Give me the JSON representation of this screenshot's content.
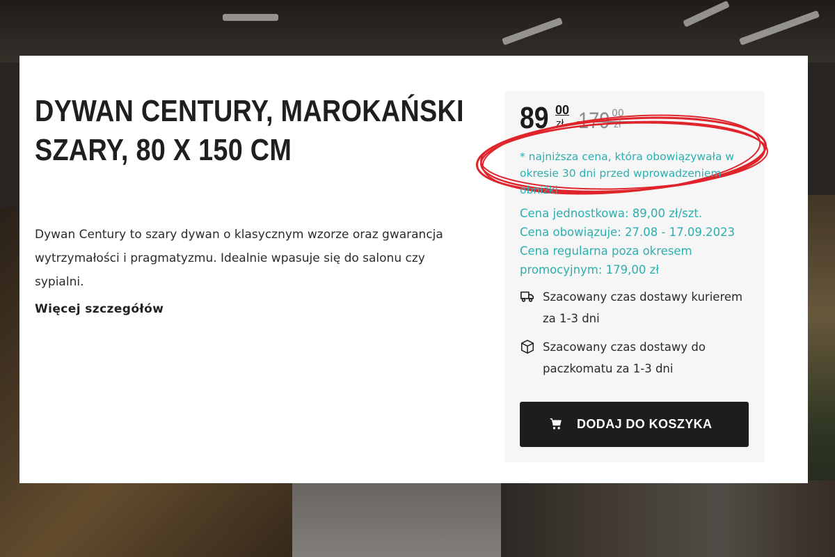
{
  "product": {
    "title": "DYWAN CENTURY, MAROKAŃSKI SZARY, 80 X 150 CM",
    "description": "Dywan Century to szary dywan o klasycznym wzorze oraz gwarancja wytrzymałości i pragmatyzmu. Idealnie wpasuje się do salonu czy sypialni.",
    "more_link": "Więcej szczegółów"
  },
  "price": {
    "current_integer": "89",
    "current_decimal": "00",
    "current_unit": "zł",
    "old_integer": "179",
    "old_decimal": "00",
    "old_unit": "zł",
    "lowest_price_note": "* najniższa cena, która obowiązywała w okresie 30 dni przed wprowadzeniem obniżki",
    "unit_price": "Cena jednostkowa: 89,00 zł/szt.",
    "valid_period": "Cena obowiązuje: 27.08 - 17.09.2023",
    "regular_price": "Cena regularna poza okresem promocyjnym: 179,00 zł"
  },
  "shipping": [
    {
      "icon": "delivery-truck-icon",
      "text": "Szacowany czas dostawy kurierem za 1-3 dni"
    },
    {
      "icon": "package-box-icon",
      "text": "Szacowany czas dostawy do paczkomatu za 1-3 dni"
    }
  ],
  "cart_button": {
    "label": "DODAJ DO KOSZYKA",
    "icon": "cart-icon"
  },
  "colors": {
    "accent_teal": "#2bafb0",
    "highlight_red": "#e0242b",
    "button_dark": "#1d1d1d"
  }
}
